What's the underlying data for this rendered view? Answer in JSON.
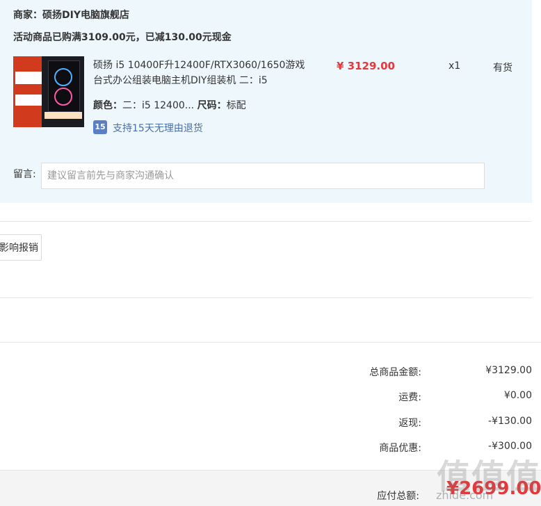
{
  "shop": {
    "label": "商家：",
    "name": "硕扬DIY电脑旗舰店",
    "promotion": "活动商品已购满3109.00元，已减130.00元现金"
  },
  "item": {
    "title": "硕扬 i5 10400F升12400F/RTX3060/1650游戏台式办公组装电脑主机DIY组装机 二：i5",
    "price": "¥ 3129.00",
    "quantity": "x1",
    "stock": "有货",
    "color_label": "颜色：",
    "color_value": "二：i5 12400...",
    "size_label": "尺码：",
    "size_value": "标配",
    "return_icon": "15",
    "return_policy": "支持15天无理由退货"
  },
  "remark": {
    "label": "留言:",
    "placeholder": "建议留言前先与商家沟通确认"
  },
  "invoice": {
    "button_label": "影响报销"
  },
  "summary": {
    "total_label": "总商品金额:",
    "total_value": "¥3129.00",
    "shipping_label": "运费:",
    "shipping_value": "¥0.00",
    "cashback_label": "返现:",
    "cashback_value": "-¥130.00",
    "discount_label": "商品优惠:",
    "discount_value": "-¥300.00"
  },
  "payment": {
    "label": "应付总额:",
    "value": "¥2699.00"
  },
  "watermark": {
    "text": "值值值",
    "sub": "zhide.com"
  },
  "colors": {
    "accent": "#e4393c",
    "panel_bg": "#eef7fc",
    "link": "#4a6ea9"
  }
}
